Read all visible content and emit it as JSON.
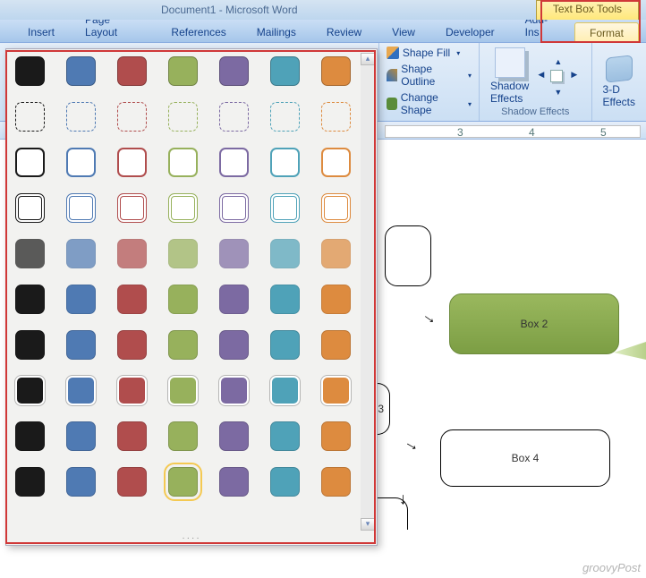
{
  "title": {
    "doc_name": "Document1",
    "app_name": "Microsoft Word"
  },
  "contextual_group_label": "Text Box Tools",
  "tabs": {
    "insert": "Insert",
    "page_layout": "Page Layout",
    "references": "References",
    "mailings": "Mailings",
    "review": "Review",
    "view": "View",
    "developer": "Developer",
    "addins": "Add-Ins",
    "format": "Format"
  },
  "ribbon": {
    "shape_fill": "Shape Fill",
    "shape_outline": "Shape Outline",
    "change_shape": "Change Shape",
    "shadow_effects": "Shadow\nEffects",
    "shadow_group_label": "Shadow Effects",
    "three_d": "3-D\nEffects"
  },
  "style_gallery": {
    "colors": [
      "black",
      "blue",
      "red",
      "olive",
      "purple",
      "teal",
      "orange"
    ],
    "rows": [
      "solid",
      "dashed",
      "outline",
      "double-outline",
      "light-gradient",
      "metallic",
      "glass",
      "solid-outlined",
      "center-gradient",
      "glossy"
    ],
    "selected": {
      "row": 9,
      "col": 3
    }
  },
  "ruler": {
    "numbers": [
      "3",
      "4",
      "5"
    ]
  },
  "document_boxes": {
    "box2_label": "Box 2",
    "box3_suffix": "3",
    "box4_label": "Box 4"
  },
  "watermark": "groovyPost"
}
